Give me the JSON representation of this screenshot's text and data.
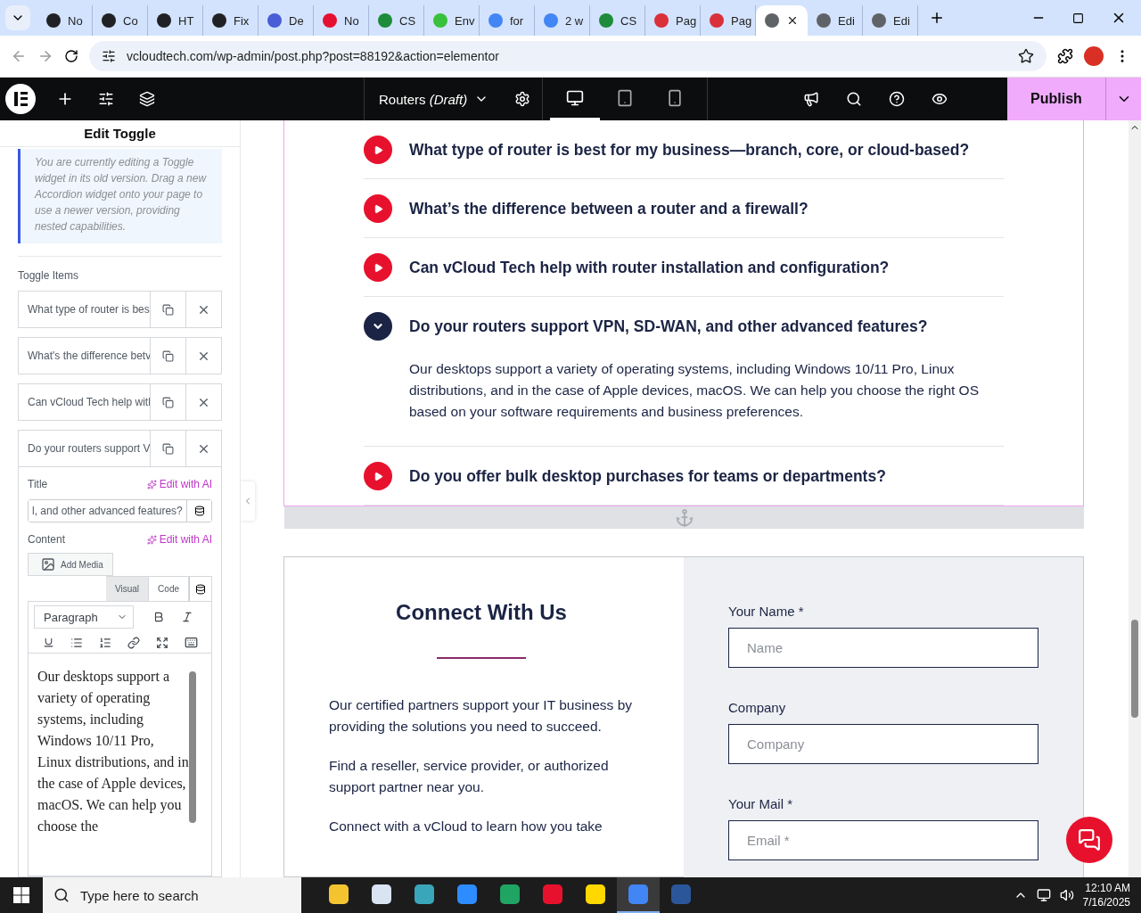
{
  "browser": {
    "tabs": [
      {
        "label": "No",
        "color": "#202124",
        "selected": false
      },
      {
        "label": "Co",
        "color": "#202124",
        "selected": false
      },
      {
        "label": "HT",
        "color": "#202124",
        "selected": false
      },
      {
        "label": "Fix",
        "color": "#202124",
        "selected": false
      },
      {
        "label": "De",
        "color": "#4a5cd6",
        "selected": false
      },
      {
        "label": "No",
        "color": "#e5102f",
        "selected": false
      },
      {
        "label": "CS",
        "color": "#1d8b3a",
        "selected": false
      },
      {
        "label": "Env",
        "color": "#38c13c",
        "selected": false
      },
      {
        "label": "for",
        "color": "#4285f4",
        "selected": false
      },
      {
        "label": "2 w",
        "color": "#4285f4",
        "selected": false
      },
      {
        "label": "CS",
        "color": "#1d8b3a",
        "selected": false
      },
      {
        "label": "Pag",
        "color": "#d9303a",
        "selected": false
      },
      {
        "label": "Pag",
        "color": "#d9303a",
        "selected": false
      },
      {
        "color": "#5f6368",
        "selected": true
      },
      {
        "label": "Edi",
        "color": "#5f6368",
        "selected": false
      },
      {
        "label": "Edi",
        "color": "#5f6368",
        "selected": false
      }
    ],
    "url": "vcloudtech.com/wp-admin/post.php?post=88192&action=elementor"
  },
  "topbar": {
    "page_title": "Routers *(Draft)*",
    "devices": [
      {
        "kind": "desktop",
        "selected": true
      },
      {
        "kind": "tablet",
        "selected": false
      },
      {
        "kind": "mobile",
        "selected": false
      }
    ],
    "publish": "Publish"
  },
  "panel": {
    "title": "Edit Toggle",
    "notice": "You are currently editing a Toggle widget in its old version. Drag a new Accordion widget onto your page to use a newer version, providing nested capabilities.",
    "section_label": "Toggle Items",
    "items": [
      "What type of router is bes",
      "What's the difference betv",
      "Can vCloud Tech help witl",
      "Do your routers support V"
    ],
    "title_label": "Title",
    "edit_ai": "Edit with AI",
    "title_value": "l, and other advanced features?",
    "content_label": "Content",
    "content_edit_ai": "Edit with AI",
    "add_media": "Add Media",
    "editor_tabs": [
      {
        "label": "Visual",
        "selected": true
      },
      {
        "label": "Code",
        "selected": false
      }
    ],
    "format": "Paragraph",
    "content": "Our desktops support a variety of operating systems, including Windows 10/11 Pro, Linux distributions, and in the case of Apple devices, macOS. We can help you choose the"
  },
  "faq": [
    {
      "question": "What type of router is best for my business—branch, core, or cloud-based?",
      "expanded": false
    },
    {
      "question": "What’s the difference between a router and a firewall?",
      "expanded": false
    },
    {
      "question": "Can vCloud Tech help with router installation and configuration?",
      "expanded": false
    },
    {
      "question": "Do your routers support VPN, SD-WAN, and other advanced features?",
      "expanded": true,
      "answer": "Our desktops support a variety of operating systems, including Windows 10/11 Pro, Linux distributions, and in the case of Apple devices, macOS. We can help you choose the right OS based on your software requirements and business preferences."
    },
    {
      "question": "Do you offer bulk desktop purchases for teams or departments?",
      "expanded": false
    }
  ],
  "contact": {
    "heading": "Connect With Us",
    "paragraphs": [
      "Our certified partners support your IT business by providing the solutions you need to succeed.",
      "Find a reseller, service provider, or authorized support partner near you.",
      "Connect with a vCloud to learn how you take"
    ],
    "fields": [
      {
        "label": "Your Name *",
        "placeholder": "Name"
      },
      {
        "label": "Company",
        "placeholder": "Company"
      },
      {
        "label": "Your Mail *",
        "placeholder": "Email *"
      }
    ]
  },
  "taskbar": {
    "search": "Type here to search",
    "apps": [
      {
        "kind": "files",
        "selected": false
      },
      {
        "kind": "paint",
        "selected": false
      },
      {
        "kind": "gem",
        "selected": false
      },
      {
        "kind": "zoom",
        "selected": false
      },
      {
        "kind": "edge",
        "selected": false
      },
      {
        "kind": "opera",
        "selected": false
      },
      {
        "kind": "notes",
        "selected": false
      },
      {
        "kind": "chrome",
        "selected": true
      },
      {
        "kind": "word",
        "selected": false
      }
    ],
    "time": "12:10 AM",
    "date": "7/16/2025"
  }
}
